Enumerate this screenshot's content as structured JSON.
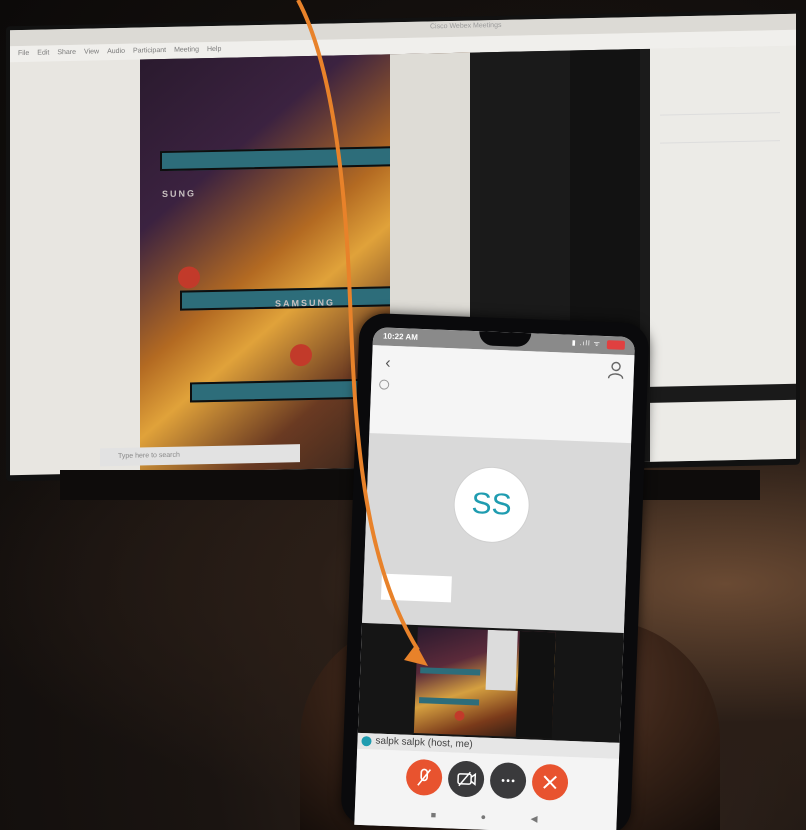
{
  "monitor": {
    "window_title": "Cisco Webex Meetings",
    "menu": [
      "File",
      "Edit",
      "Share",
      "View",
      "Audio",
      "Participant",
      "Meeting",
      "Help"
    ],
    "brand_text_1": "SUNG",
    "brand_text_2": "SAMSUNG",
    "search_placeholder": "Type here to search"
  },
  "phone": {
    "time": "10:22 AM",
    "signal": "▮ .ıll ᯤ",
    "avatar_initials": "SS",
    "participant_name": "salpk salpk (host, me)",
    "icons": {
      "back": "back-chevron-icon",
      "participants": "person-icon",
      "mute": "mic-off-icon",
      "video": "video-off-icon",
      "more": "more-icon",
      "leave": "close-icon"
    }
  },
  "colors": {
    "accent": "#1f9cb0",
    "leave": "#e8532f",
    "arrow": "#e8822a"
  }
}
